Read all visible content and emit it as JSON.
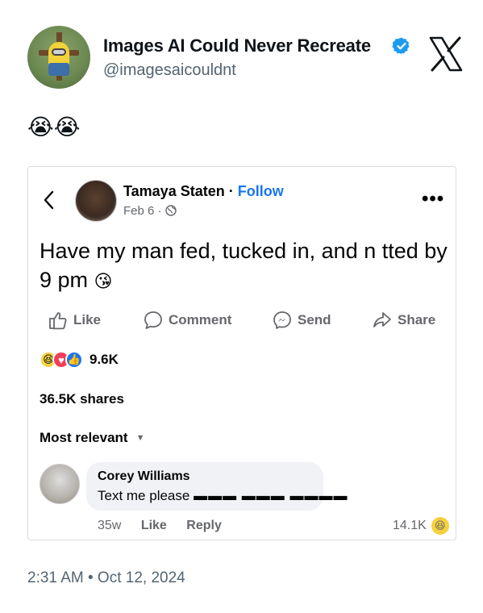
{
  "tweet": {
    "author_name": "Images AI Could Never Recreate",
    "author_handle": "@imagesaicouldnt",
    "verified": true,
    "verified_color": "#1d9bf0",
    "body_emoji": "😭😭",
    "timestamp": "2:31 AM • Oct 12, 2024"
  },
  "fb_post": {
    "author_name": "Tamaya Staten",
    "separator": " · ",
    "follow_label": "Follow",
    "follow_color": "#1877f2",
    "date": "Feb 6 · ",
    "text": "Have my man fed, tucked in, and n  tted by 9 pm",
    "text_emoji": "😘",
    "actions": {
      "like": "Like",
      "comment": "Comment",
      "send": "Send",
      "share": "Share"
    },
    "reaction_count": "9.6K",
    "shares": "36.5K shares",
    "sort_label": "Most relevant",
    "comment": {
      "author": "Corey Williams",
      "text": "Text me please",
      "redacted": "▬▬▬ ▬▬▬ ▬▬▬▬",
      "time": "35w",
      "like_label": "Like",
      "reply_label": "Reply",
      "reaction_count": "14.1K"
    }
  }
}
